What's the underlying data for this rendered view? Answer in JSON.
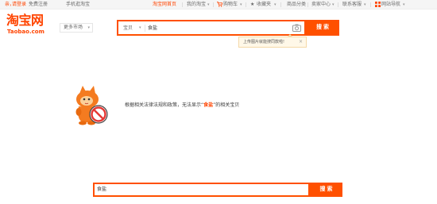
{
  "topbar": {
    "region": "亲，",
    "login": "请登录",
    "register": "免费注册",
    "mobile": "手机逛淘宝",
    "home": "淘宝网首页",
    "my_taobao": "我的淘宝",
    "cart": "购物车",
    "favorites": "收藏夹",
    "categories": "商品分类",
    "seller_center": "卖家中心",
    "customer_service": "联系客服",
    "site_nav": "网站导航"
  },
  "logo": {
    "cn": "淘宝网",
    "en": "Taobao.com"
  },
  "market": {
    "label": "更多市场"
  },
  "search": {
    "type": "宝贝",
    "query": "食盐",
    "button": "搜 索"
  },
  "tooltip": {
    "text": "上传图片就能搜同款啦!",
    "close": "×"
  },
  "message": {
    "before": "根据相关法律法规和政策，无法显示“",
    "keyword": "食盐",
    "after": "”的相关宝贝"
  },
  "bottom_search": {
    "query": "食盐",
    "button": "搜 索"
  },
  "colors": {
    "brand": "#ff5000",
    "logo": "#ff4400"
  },
  "icons": [
    "cart-icon",
    "star-icon",
    "grid-icon",
    "camera-icon",
    "no-entry-icon"
  ]
}
